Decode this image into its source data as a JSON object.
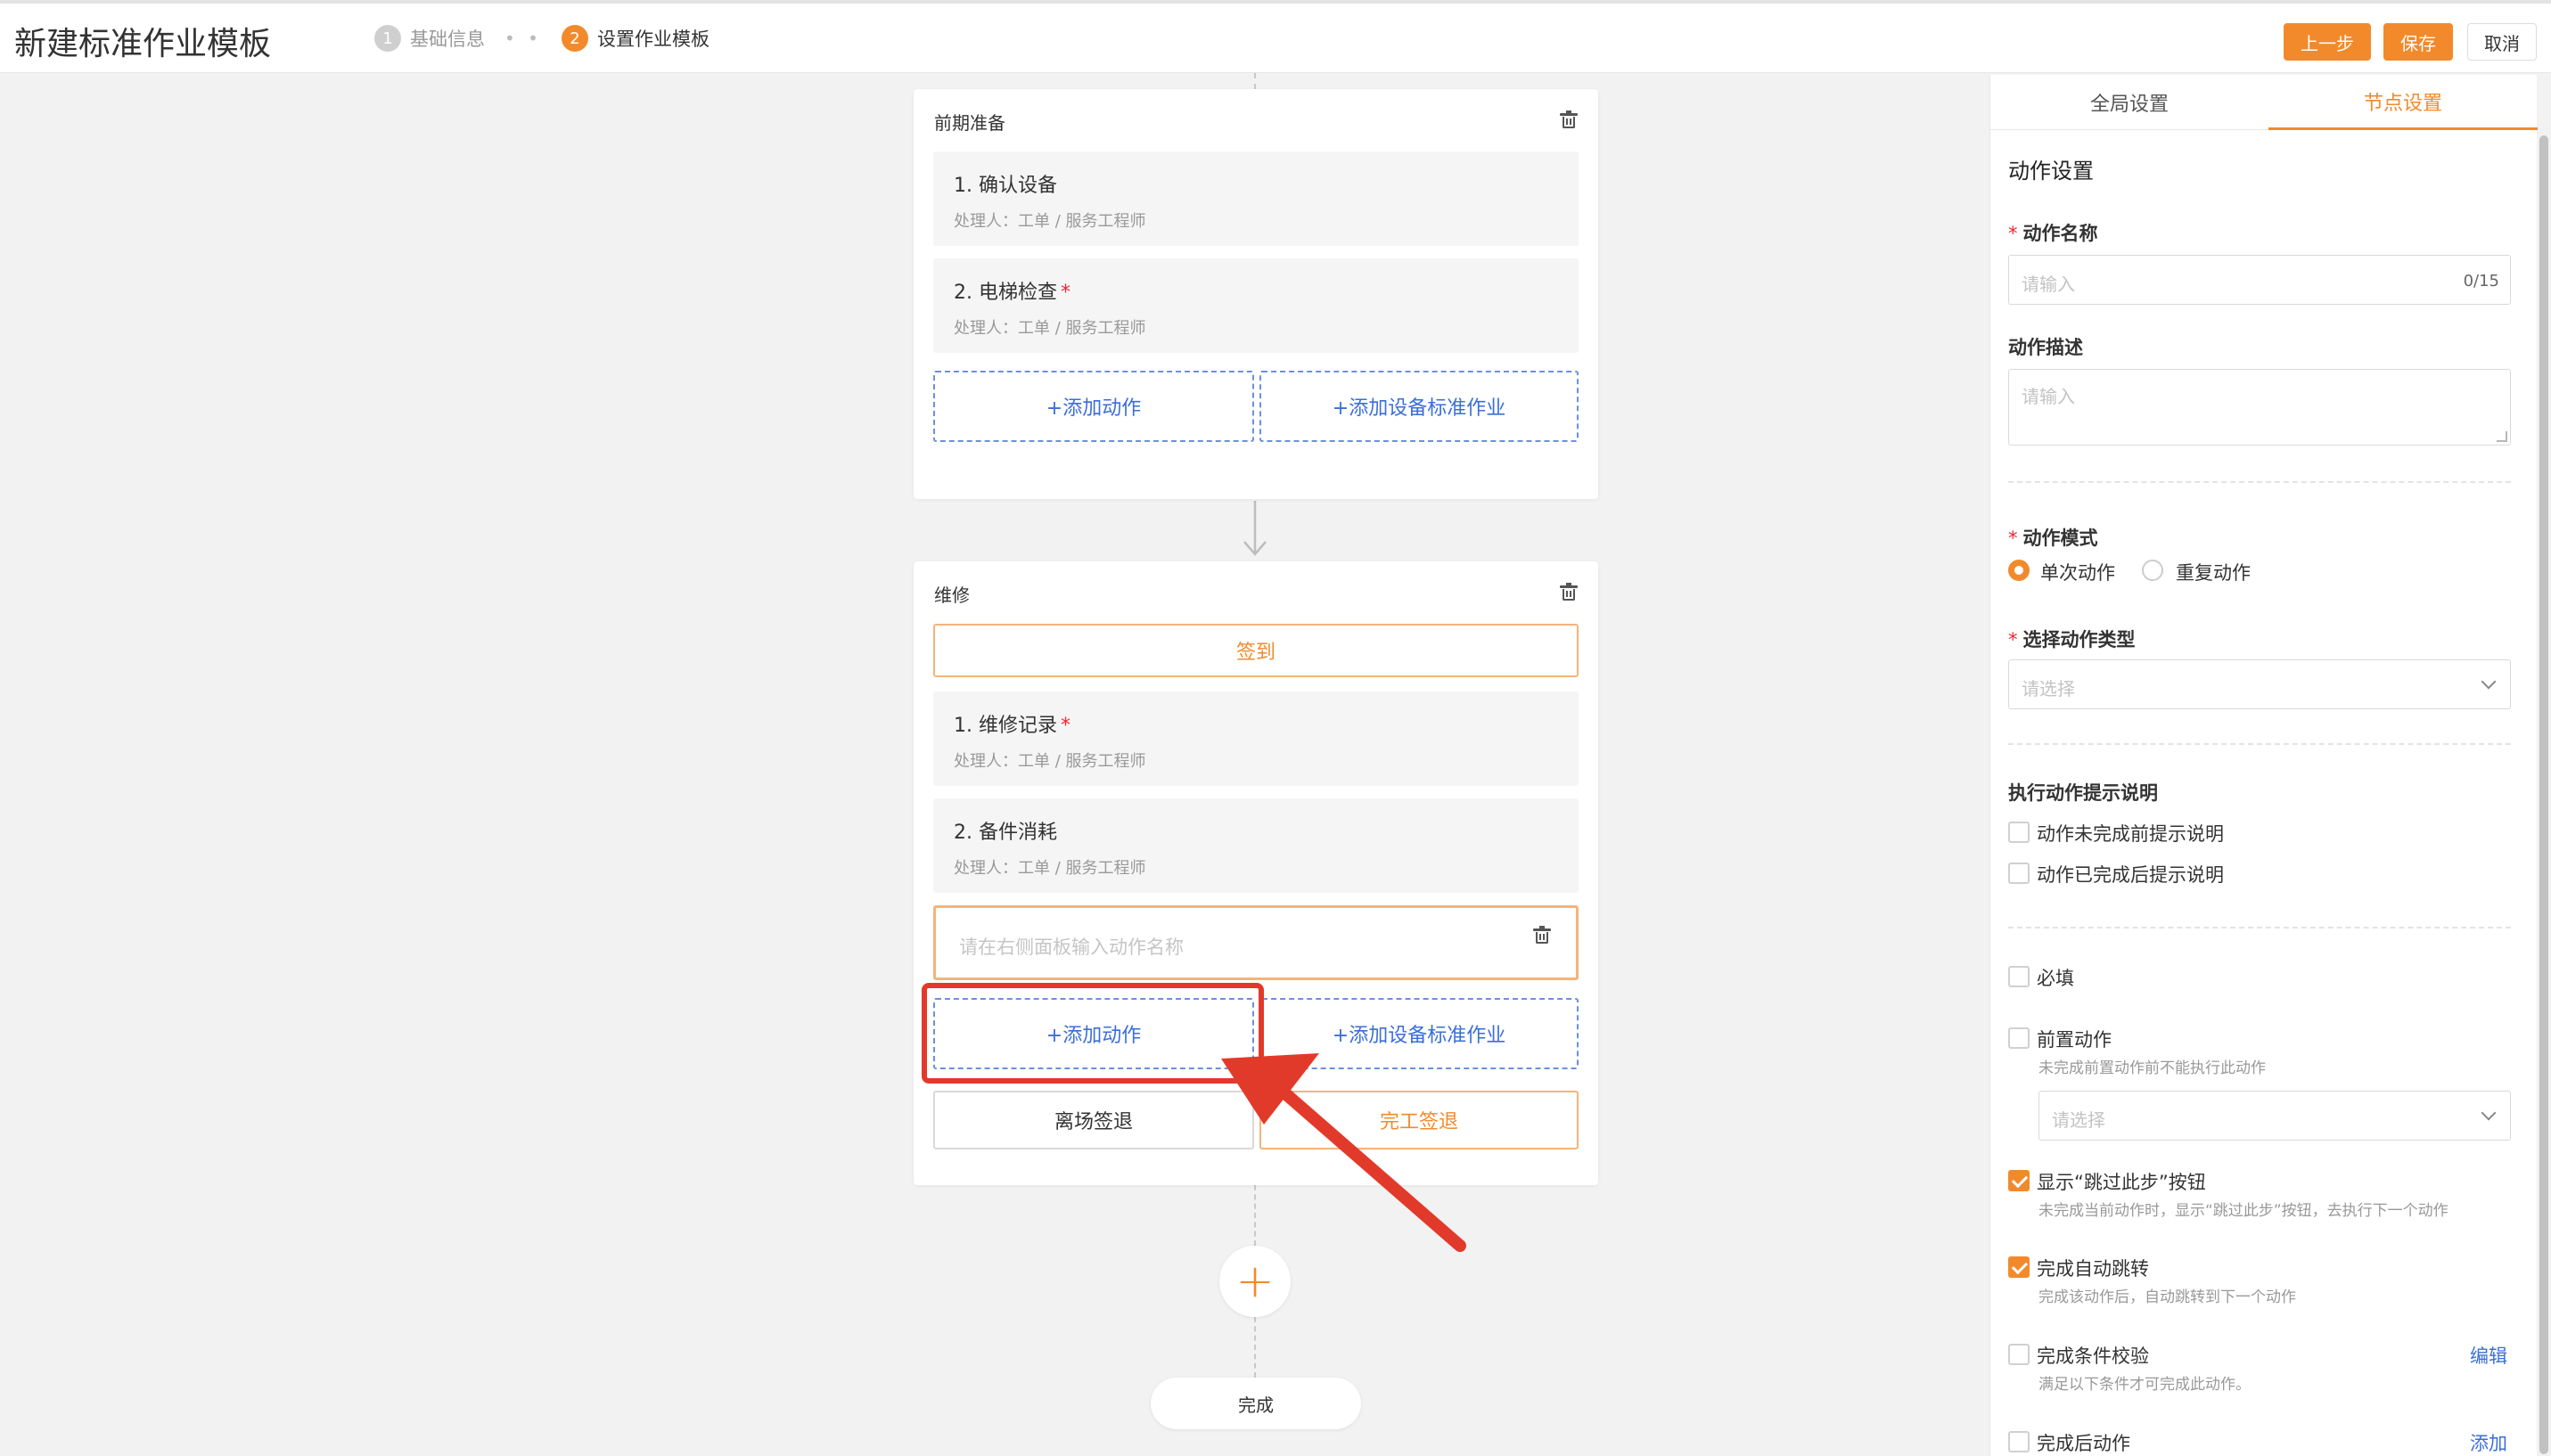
{
  "header": {
    "title": "新建标准作业模板",
    "steps": [
      {
        "num": "1",
        "label": "基础信息"
      },
      {
        "num": "2",
        "label": "设置作业模板"
      }
    ],
    "step_separator": "• •",
    "buttons": {
      "prev": "上一步",
      "save": "保存",
      "cancel": "取消"
    }
  },
  "canvas": {
    "stage1": {
      "title": "前期准备",
      "actions": [
        {
          "name": "1. 确认设备",
          "required": "",
          "handler": "处理人：工单 / 服务工程师"
        },
        {
          "name": "2. 电梯检查",
          "required": "*",
          "handler": "处理人：工单 / 服务工程师"
        }
      ],
      "add_action": "+添加动作",
      "add_device_sop": "+添加设备标准作业"
    },
    "stage2": {
      "title": "维修",
      "checkin": "签到",
      "actions": [
        {
          "name": "1. 维修记录",
          "required": "*",
          "handler": "处理人：工单 / 服务工程师"
        },
        {
          "name": "2. 备件消耗",
          "required": "",
          "handler": "处理人：工单 / 服务工程师"
        }
      ],
      "new_action_placeholder": "请在右侧面板输入动作名称",
      "add_action": "+添加动作",
      "add_device_sop": "+添加设备标准作业",
      "leave_checkout": "离场签退",
      "complete_checkout": "完工签退"
    },
    "add_stage_symbol": "+",
    "finish": "完成"
  },
  "panel": {
    "tabs": {
      "global": "全局设置",
      "node": "节点设置"
    },
    "section_title": "动作设置",
    "action_name": {
      "label": "动作名称",
      "required": "*",
      "placeholder": "请输入",
      "count": "0/15"
    },
    "action_desc": {
      "label": "动作描述",
      "placeholder": "请输入"
    },
    "action_mode": {
      "label": "动作模式",
      "required": "*",
      "option_single": "单次动作",
      "option_repeat": "重复动作"
    },
    "action_type": {
      "label": "选择动作类型",
      "required": "*",
      "placeholder": "请选择"
    },
    "hint_section": {
      "title": "执行动作提示说明",
      "before": "动作未完成前提示说明",
      "after": "动作已完成后提示说明"
    },
    "required_check": "必填",
    "pre_action": {
      "label": "前置动作",
      "hint": "未完成前置动作前不能执行此动作",
      "placeholder": "请选择"
    },
    "skip_button": {
      "label": "显示“跳过此步”按钮",
      "hint": "未完成当前动作时，显示“跳过此步”按钮，去执行下一个动作"
    },
    "auto_jump": {
      "label": "完成自动跳转",
      "hint": "完成该动作后，自动跳转到下一个动作"
    },
    "condition_check": {
      "label": "完成条件校验",
      "hint": "满足以下条件才可完成此动作。",
      "link": "编辑"
    },
    "post_action": {
      "label": "完成后动作",
      "link": "添加"
    }
  },
  "colors": {
    "accent": "#f28a2c",
    "link": "#3b6ed8",
    "annotation": "#e23a2a"
  }
}
